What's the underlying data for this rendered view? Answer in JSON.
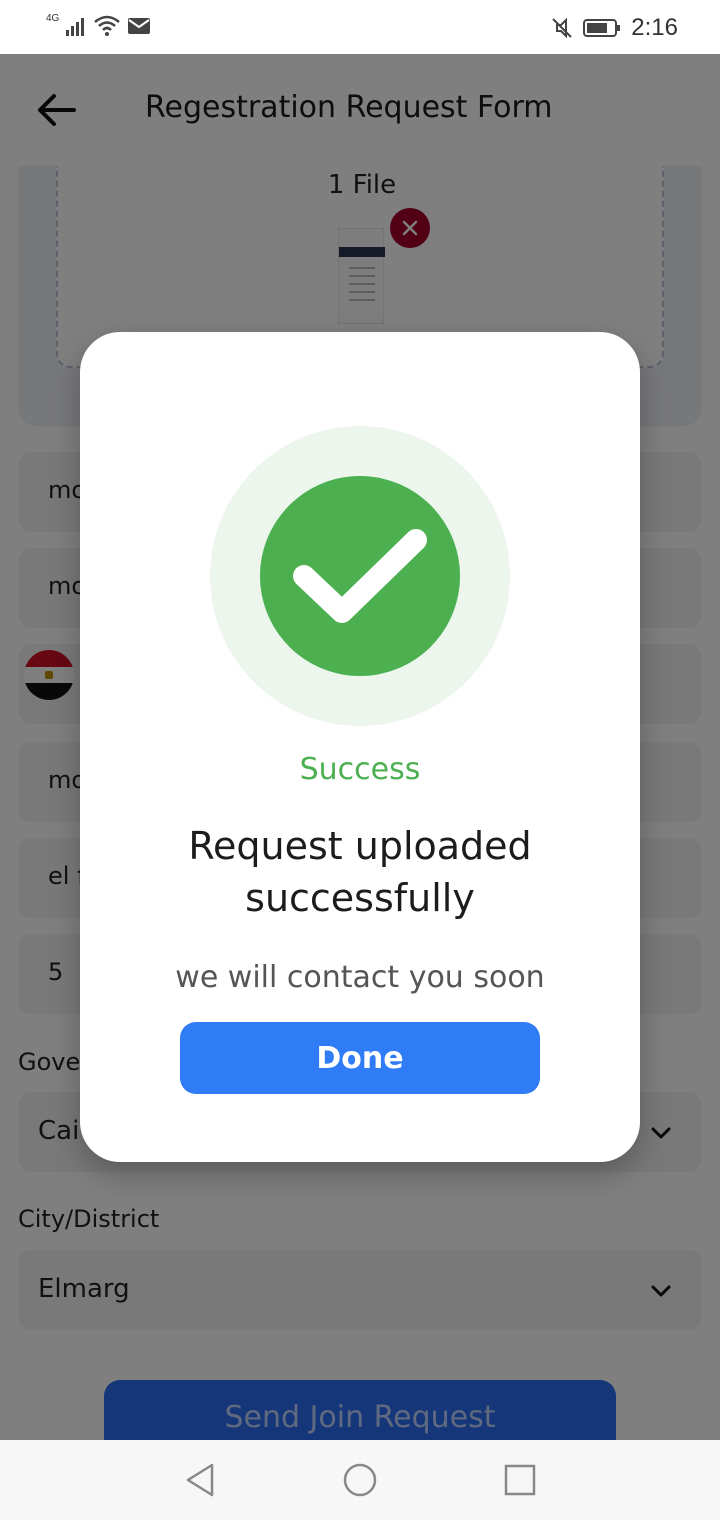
{
  "status_bar": {
    "network": "4G",
    "time": "2:16"
  },
  "header": {
    "title": "Regestration Request Form"
  },
  "upload": {
    "file_count": "1 File"
  },
  "fields": [
    {
      "value": "mo"
    },
    {
      "value": "mo"
    },
    {
      "value": ""
    },
    {
      "value": "mo"
    },
    {
      "value": "el f"
    },
    {
      "value": "5"
    }
  ],
  "governorate": {
    "label": "Gove",
    "value": "Cai"
  },
  "city": {
    "label": "City/District",
    "value": "Elmarg"
  },
  "send_button": {
    "label": "Send Join Request"
  },
  "dialog": {
    "title": "Success",
    "message": "Request uploaded successfully",
    "subtitle": "we will contact you soon",
    "done_label": "Done"
  },
  "colors": {
    "success": "#4cb050",
    "primary": "#2f7cf6",
    "remove": "#a3002a"
  }
}
